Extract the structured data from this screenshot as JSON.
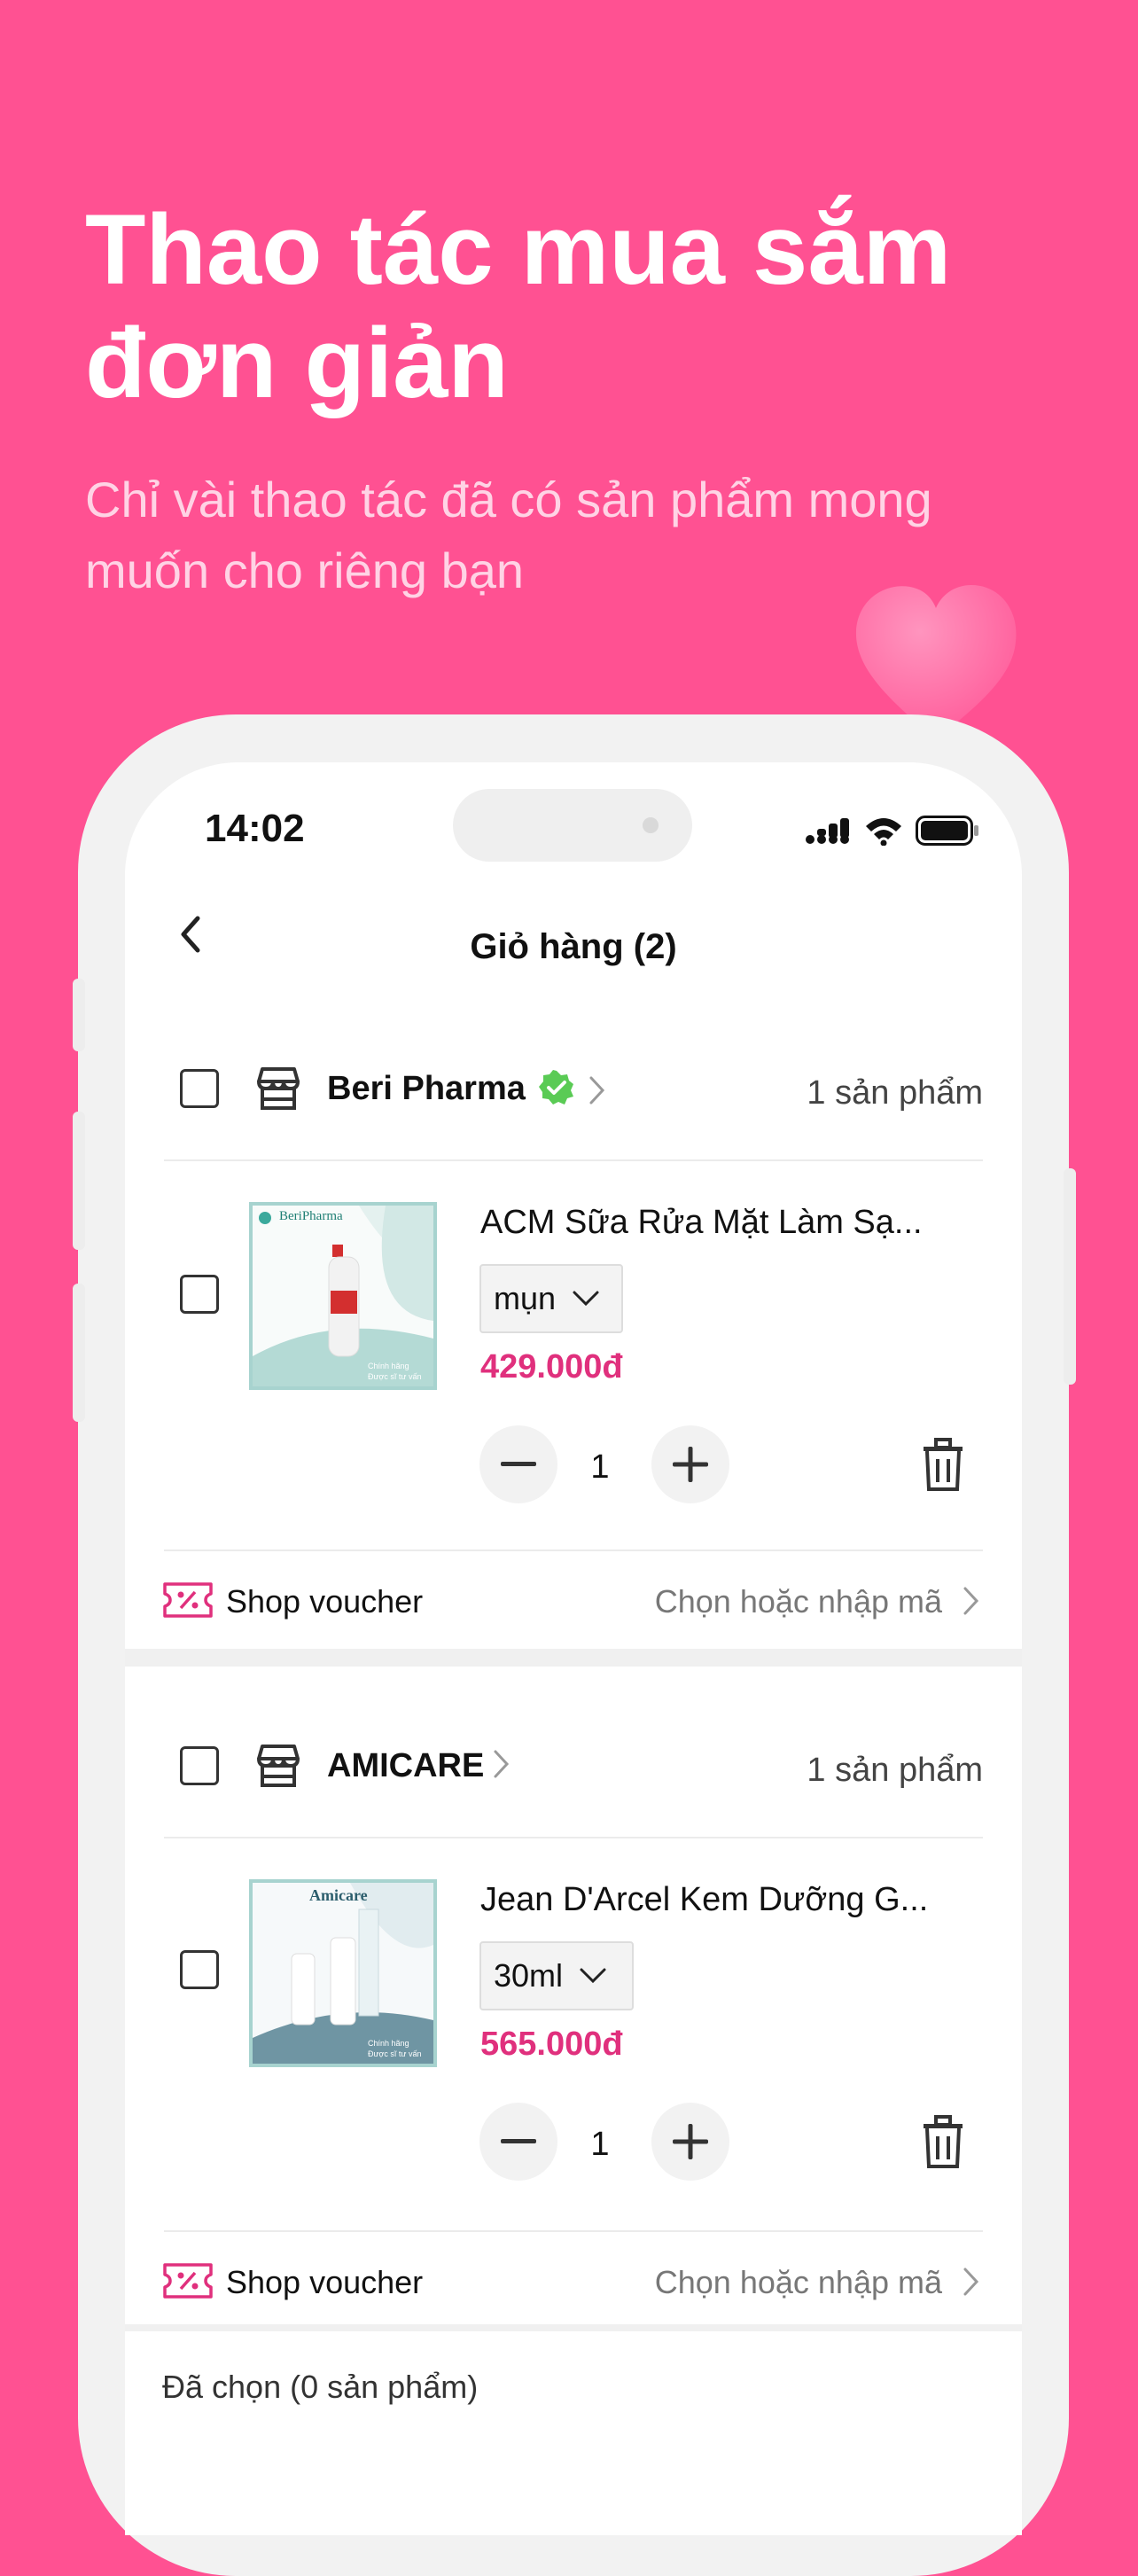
{
  "promo": {
    "headline_line1": "Thao tác mua sắm",
    "headline_line2": "đơn giản",
    "subline_line1": "Chỉ vài thao tác đã có sản phẩm mong",
    "subline_line2": "muốn cho riêng bạn"
  },
  "colors": {
    "background": "#FF5192",
    "price": "#E0307D",
    "verified_badge": "#5ACB55"
  },
  "status_bar": {
    "time": "14:02"
  },
  "nav": {
    "title": "Giỏ hàng (2)",
    "back_icon": "chevron-left-icon"
  },
  "shops": [
    {
      "name": "Beri Pharma",
      "verified": true,
      "count_text": "1 sản phẩm",
      "product": {
        "name": "ACM Sữa Rửa Mặt Làm Sạ...",
        "variant": "mụn",
        "price": "429.000đ",
        "quantity": "1",
        "thumb_brand": "BeriPharma",
        "thumb_tag1": "Chính hãng",
        "thumb_tag2": "Được sĩ tư vấn"
      },
      "voucher": {
        "label": "Shop voucher",
        "action": "Chọn hoặc nhập mã"
      }
    },
    {
      "name": "AMICARE",
      "verified": false,
      "count_text": "1 sản phẩm",
      "product": {
        "name": "Jean D'Arcel Kem Dưỡng G...",
        "variant": "30ml",
        "price": "565.000đ",
        "quantity": "1",
        "thumb_brand": "Amicare",
        "thumb_tag1": "Chính hãng",
        "thumb_tag2": "Được sĩ tư vấn"
      },
      "voucher": {
        "label": "Shop voucher",
        "action": "Chọn hoặc nhập mã"
      }
    }
  ],
  "footer": {
    "selected_text": "Đã chọn (0 sản phẩm)"
  }
}
